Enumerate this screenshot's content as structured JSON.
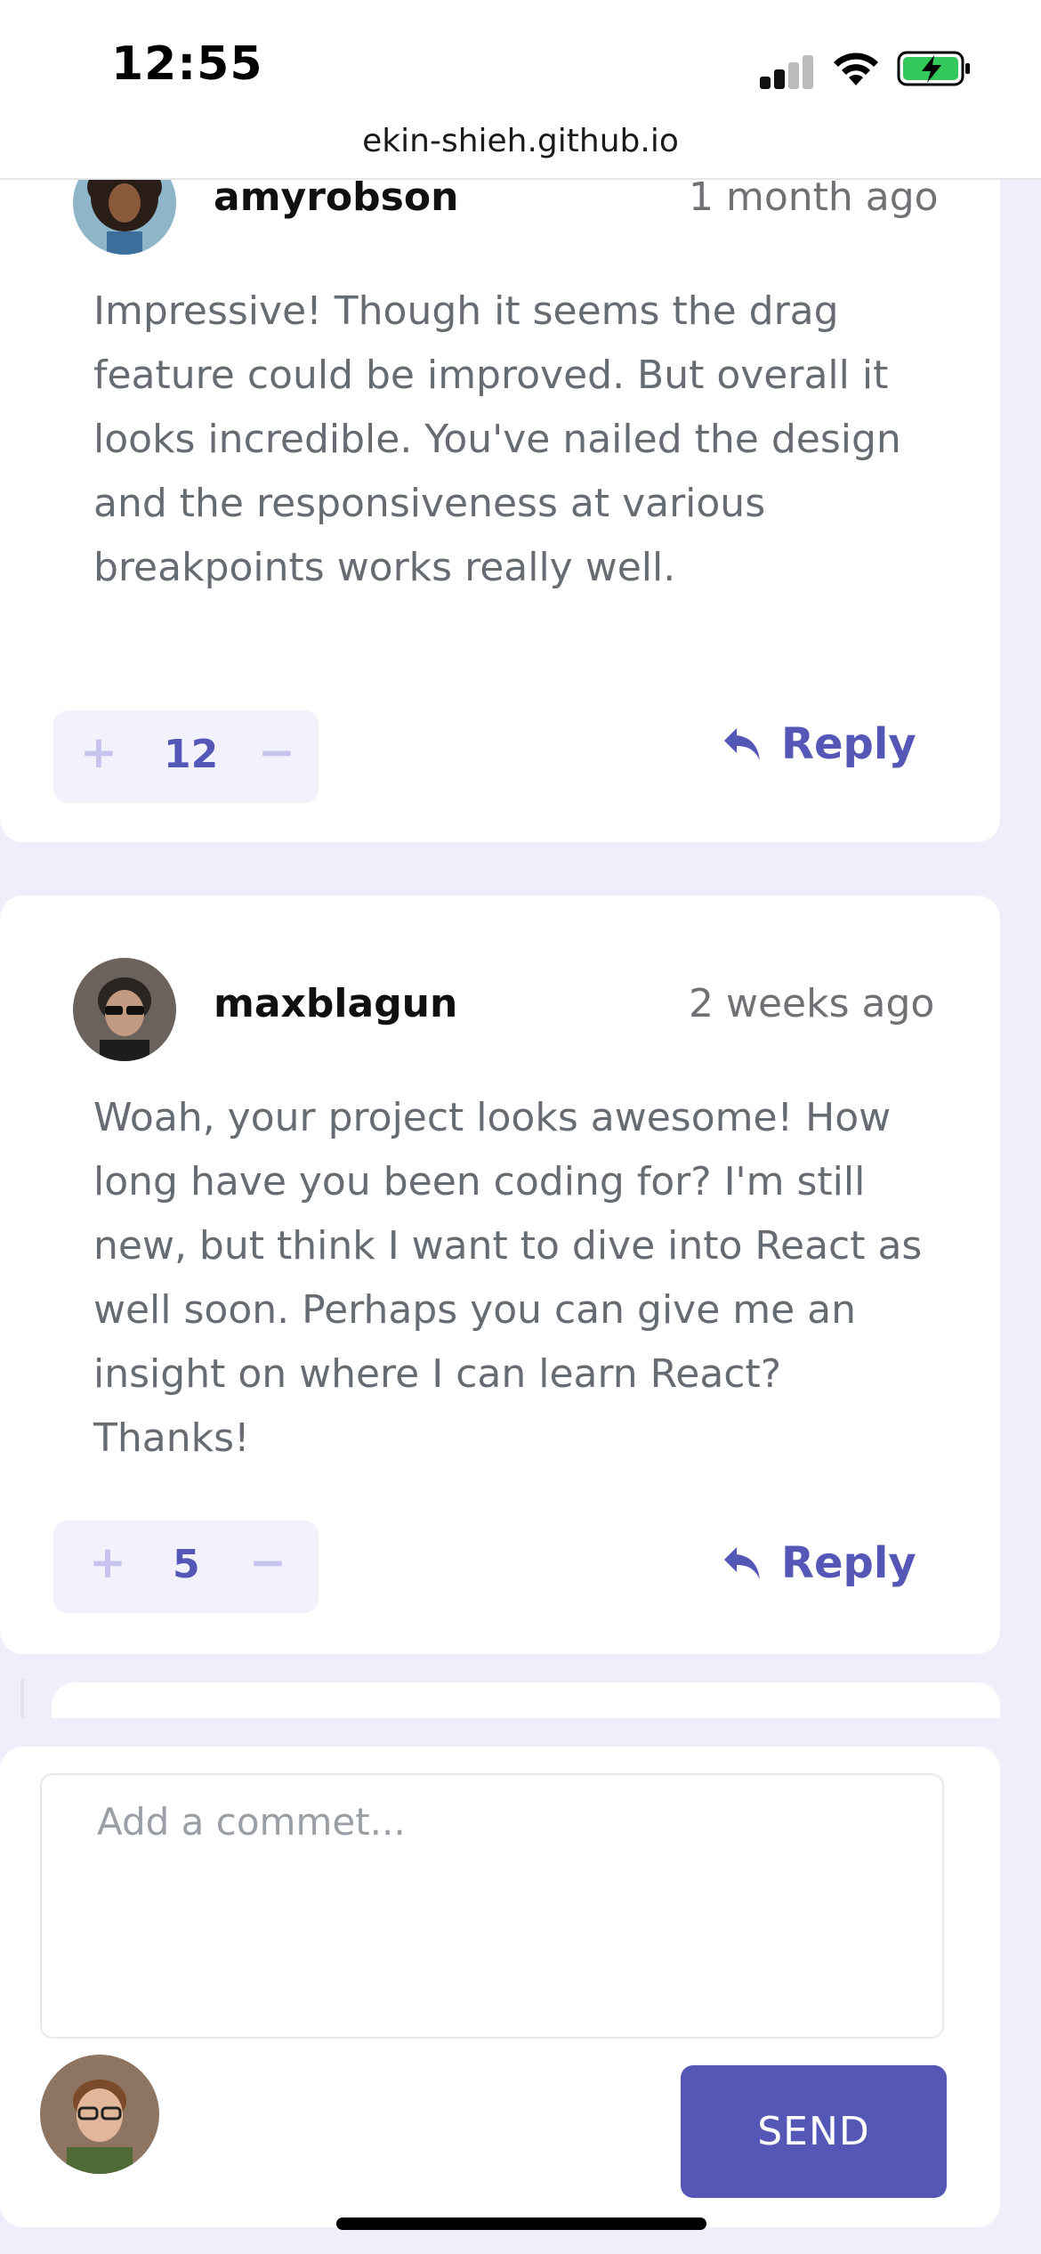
{
  "status_bar": {
    "time": "12:55",
    "url": "ekin-shieh.github.io"
  },
  "comments": [
    {
      "username": "amyrobson",
      "time_ago": "1 month ago",
      "text_lines": [
        "Impressive! Though it seems the drag",
        "feature could be improved. But overall it",
        "looks incredible. You've nailed the design",
        "and the responsiveness at various",
        "breakpoints works really well."
      ],
      "score": "12",
      "reply_label": "Reply"
    },
    {
      "username": "maxblagun",
      "time_ago": "2 weeks ago",
      "text_lines": [
        "Woah, your project looks awesome! How",
        "long have you been coding for? I'm still",
        "new, but think I want to dive into React as",
        "well soon. Perhaps you can give me an",
        "insight on where I can learn React?",
        "Thanks!"
      ],
      "score": "5",
      "reply_label": "Reply"
    }
  ],
  "vote": {
    "plus": "+",
    "minus": "−"
  },
  "compose": {
    "placeholder": "Add a commet...",
    "send_label": "SEND"
  },
  "colors": {
    "accent": "#5457b6",
    "background": "#efeefb",
    "text": "#676c73"
  }
}
